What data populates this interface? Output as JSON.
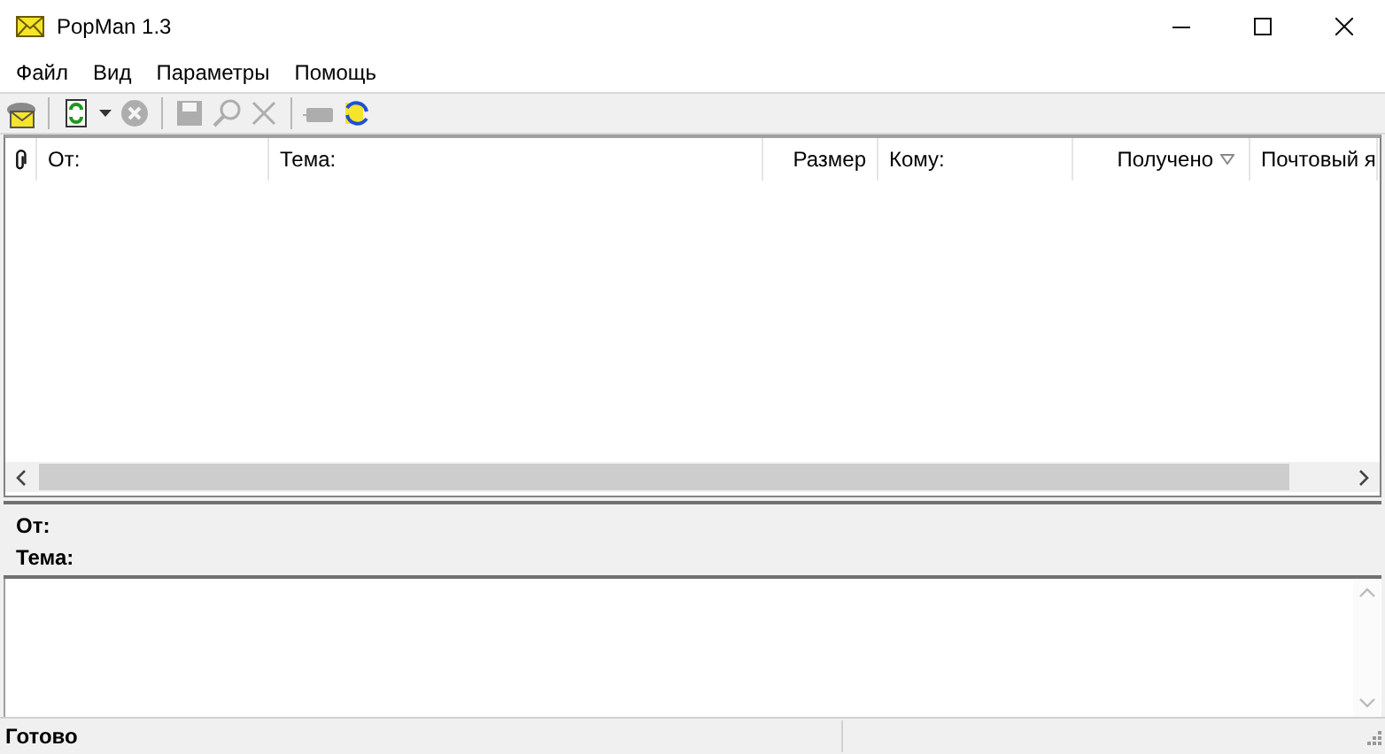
{
  "window": {
    "title": "PopMan 1.3"
  },
  "menu": [
    {
      "label": "Файл"
    },
    {
      "label": "Вид"
    },
    {
      "label": "Параметры"
    },
    {
      "label": "Помощь"
    }
  ],
  "toolbar": [
    {
      "kind": "mailbox",
      "disabled": false
    },
    {
      "kind": "sep"
    },
    {
      "kind": "check",
      "disabled": false
    },
    {
      "kind": "dropdown",
      "disabled": false
    },
    {
      "kind": "stop",
      "disabled": true
    },
    {
      "kind": "sep"
    },
    {
      "kind": "save",
      "disabled": true
    },
    {
      "kind": "find",
      "disabled": true
    },
    {
      "kind": "delete",
      "disabled": true
    },
    {
      "kind": "sep"
    },
    {
      "kind": "send",
      "disabled": true
    },
    {
      "kind": "sync",
      "disabled": false
    }
  ],
  "table": {
    "columns": [
      {
        "kind": "attach",
        "sorted": false
      },
      {
        "label": "От:",
        "sorted": false
      },
      {
        "label": "Тема:",
        "sorted": false
      },
      {
        "label": "Размер",
        "sorted": false
      },
      {
        "label": "Кому:",
        "sorted": false
      },
      {
        "label": "Получено",
        "sorted": true
      },
      {
        "label": "Почтовый я",
        "sorted": false
      }
    ]
  },
  "preview": {
    "fields": [
      {
        "label": "От:"
      },
      {
        "label": "Тема:"
      }
    ]
  },
  "status_bar": {
    "text": "Готово"
  }
}
